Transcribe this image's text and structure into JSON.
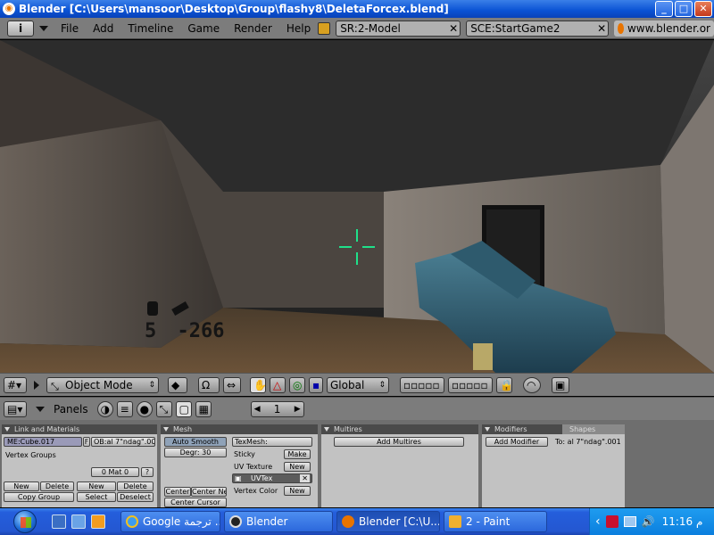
{
  "titlebar": {
    "title": "Blender [C:\\Users\\mansoor\\Desktop\\Group\\flashy8\\DeletaForcex.blend]"
  },
  "menubar": {
    "info_label": "i",
    "items": [
      "File",
      "Add",
      "Timeline",
      "Game",
      "Render",
      "Help"
    ],
    "screen": "SR:2-Model",
    "scene": "SCE:StartGame2",
    "url": "www.blender.or"
  },
  "hud": {
    "ammo": "5",
    "score": "-266"
  },
  "view3d_header": {
    "mode": "Object Mode",
    "orientation": "Global"
  },
  "buttons_header": {
    "label": "Panels",
    "frame": "1"
  },
  "panels": {
    "link_materials": {
      "title": "Link and Materials",
      "mesh_name": "ME:Cube.017",
      "f_label": "F",
      "ob_name": "OB:al 7\"ndag\".001",
      "vertex_groups": "Vertex Groups",
      "mat_counter": "0 Mat 0",
      "question": "?",
      "new1": "New",
      "delete1": "Delete",
      "copy_group": "Copy Group",
      "new2": "New",
      "delete2": "Delete",
      "select": "Select",
      "deselect": "Deselect"
    },
    "mesh": {
      "title": "Mesh",
      "auto_smooth": "Auto Smooth",
      "degr": "Degr: 30",
      "center": "Center",
      "center_new": "Center Ne",
      "center_cursor": "Center Cursor",
      "texmesh": "TexMesh:",
      "sticky": "Sticky",
      "make": "Make",
      "uv_texture": "UV Texture",
      "new_uv": "New",
      "uvtex": "UVTex",
      "vertex_color": "Vertex Color",
      "new_vc": "New"
    },
    "multires": {
      "title": "Multires",
      "add": "Add Multires"
    },
    "modifiers": {
      "tab1": "Modifiers",
      "tab2": "Shapes",
      "add": "Add Modifier",
      "to": "To: al 7\"ndag\".001"
    }
  },
  "taskbar": {
    "tasks": [
      "Google ترجمة ...",
      "Blender",
      "Blender [C:\\U...",
      "2 - Paint"
    ],
    "clock": "11:16",
    "ampm": "م"
  }
}
